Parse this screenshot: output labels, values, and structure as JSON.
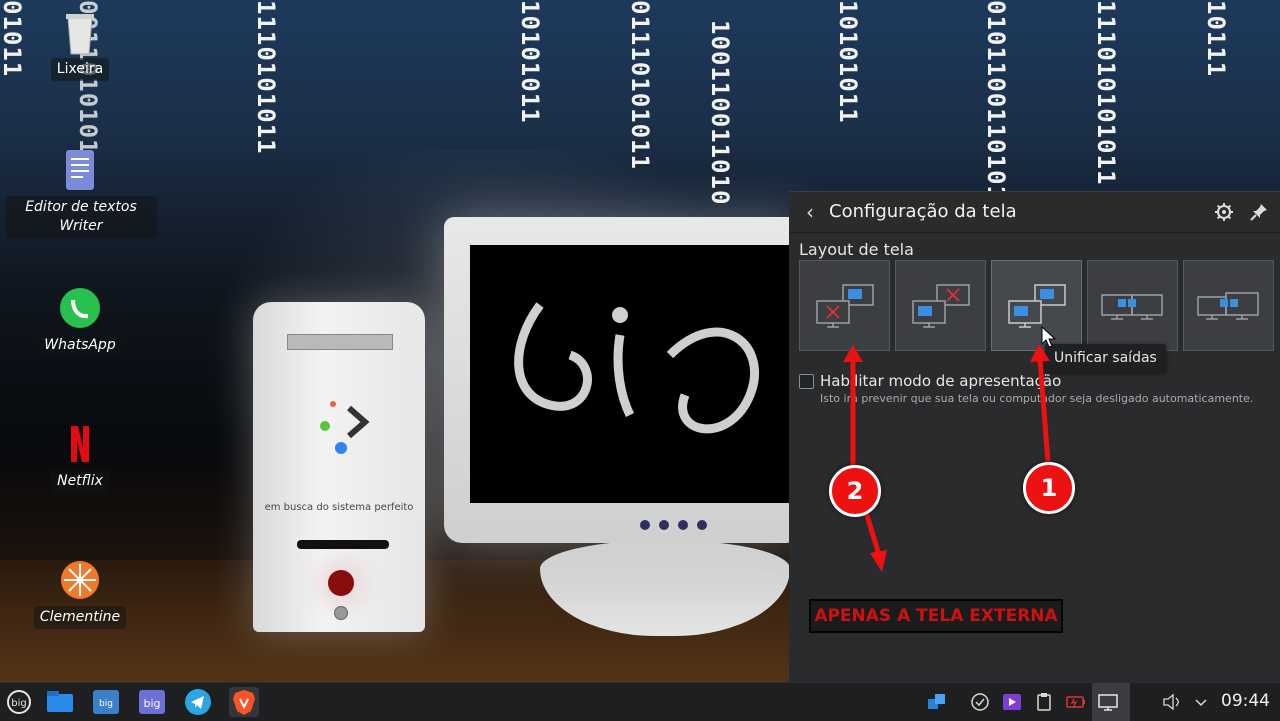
{
  "wallpaper": {
    "binary_columns": [
      "01011",
      "0011010101",
      "1110101011",
      "10101011",
      "01110101011",
      "100110011010",
      "10101011",
      "01011001101010",
      "111010101011",
      "10111"
    ],
    "tower_caption": "em busca do sistema perfeito"
  },
  "desktop": {
    "icons": [
      {
        "label": "Lixeira",
        "icon": "trash-icon"
      },
      {
        "label": "Editor de textos Writer",
        "icon": "writer-document-icon"
      },
      {
        "label": "WhatsApp",
        "icon": "whatsapp-icon"
      },
      {
        "label": "Netflix",
        "icon": "netflix-icon"
      },
      {
        "label": "Clementine",
        "icon": "clementine-icon"
      }
    ]
  },
  "panel": {
    "title": "Configuração da tela",
    "section_label": "Layout de tela",
    "layout_options": [
      {
        "id": "external-only",
        "icon": "layout-external-only-icon"
      },
      {
        "id": "internal-only",
        "icon": "layout-internal-only-icon"
      },
      {
        "id": "unify-outputs",
        "icon": "layout-unify-icon"
      },
      {
        "id": "extend-left",
        "icon": "layout-extend-left-icon"
      },
      {
        "id": "extend-right",
        "icon": "layout-extend-right-icon"
      }
    ],
    "tooltip": "Unificar saídas",
    "presentation_mode": {
      "label": "Habilitar modo de apresentação",
      "hint": "Isto irá prevenir que sua tela ou computador seja desligado automaticamente.",
      "checked": false
    },
    "annotation_text": "APENAS A TELA EXTERNA"
  },
  "annotations": {
    "badge_1": "1",
    "badge_2": "2",
    "color": "#ee1111"
  },
  "taskbar": {
    "apps": [
      "big-launcher-icon",
      "file-manager-icon",
      "big-store-icon",
      "big-control-icon",
      "telegram-icon",
      "brave-icon"
    ],
    "tray": [
      "dropbox-icon",
      "check-circle-icon",
      "media-player-icon",
      "clipboard-icon",
      "battery-icon",
      "display-icon",
      "volume-icon",
      "chevron-up-icon"
    ],
    "clock": "09:44"
  },
  "colors": {
    "panel_bg": "#2a2b2d",
    "accent_red": "#ee1111",
    "taskbar_bg": "#1e1f21"
  }
}
